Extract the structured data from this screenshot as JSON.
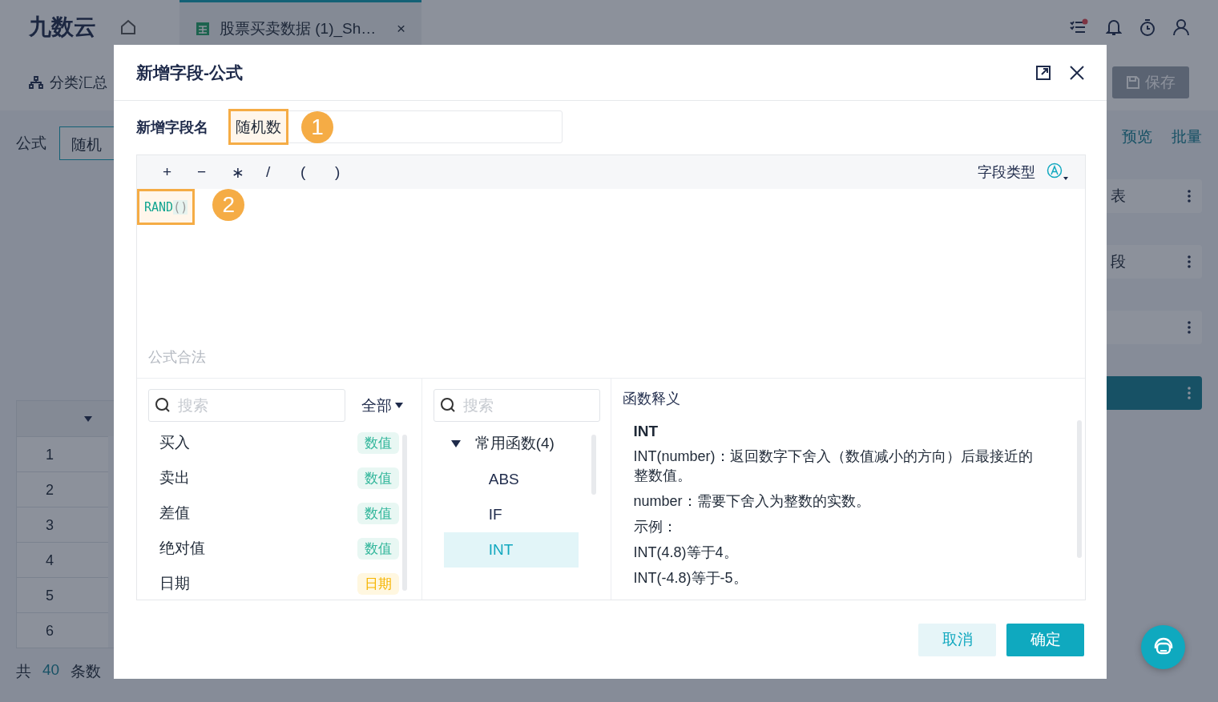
{
  "header": {
    "logo": "九数云",
    "tab": {
      "title": "股票买卖数据 (1)_Sh…",
      "close": "×",
      "selected": true
    },
    "task_dot": true
  },
  "toolbar": {
    "summary": "分类汇总",
    "save": "保存"
  },
  "formula_row": {
    "label": "公式",
    "value": "随机"
  },
  "side_panel": {
    "links": [
      "预览",
      "批量"
    ],
    "steps": [
      {
        "label": "表",
        "selected": false
      },
      {
        "label": "段",
        "selected": false
      },
      {
        "selected": false
      },
      {
        "selected": true
      }
    ]
  },
  "table": {
    "rows": [
      "1",
      "2",
      "3",
      "4",
      "5",
      "6"
    ]
  },
  "footer": {
    "prefix": "共",
    "count": "40",
    "suffix": "条数"
  },
  "dialog": {
    "title": "新增字段-公式",
    "name_field": {
      "label": "新增字段名",
      "value": "随机数"
    },
    "callouts": [
      "1",
      "2"
    ],
    "operators": [
      "+",
      "−",
      "∗",
      "/",
      "(",
      ")"
    ],
    "field_type": "字段类型",
    "formula": {
      "function": "RAND",
      "args": "()"
    },
    "status": "公式合法",
    "fields": {
      "placeholder": "搜索",
      "filter": "全部",
      "items": [
        {
          "name": "买入",
          "type": "数值",
          "kind": "number"
        },
        {
          "name": "卖出",
          "type": "数值",
          "kind": "number"
        },
        {
          "name": "差值",
          "type": "数值",
          "kind": "number"
        },
        {
          "name": "绝对值",
          "type": "数值",
          "kind": "number"
        },
        {
          "name": "日期",
          "type": "日期",
          "kind": "date"
        }
      ]
    },
    "functions": {
      "placeholder": "搜索",
      "groups": [
        {
          "label": "常用函数(4)",
          "expanded": true,
          "children": [
            {
              "label": "ABS",
              "selected": false
            },
            {
              "label": "IF",
              "selected": false
            },
            {
              "label": "INT",
              "selected": true
            }
          ]
        }
      ]
    },
    "description": {
      "title": "函数释义",
      "name": "INT",
      "lines": [
        "INT(number)：返回数字下舍入（数值减小的方向）后最接近的整数值。",
        "number：需要下舍入为整数的实数。",
        "示例：",
        "INT(4.8)等于4。",
        "INT(-4.8)等于-5。"
      ]
    },
    "buttons": {
      "cancel": "取消",
      "ok": "确定"
    }
  }
}
